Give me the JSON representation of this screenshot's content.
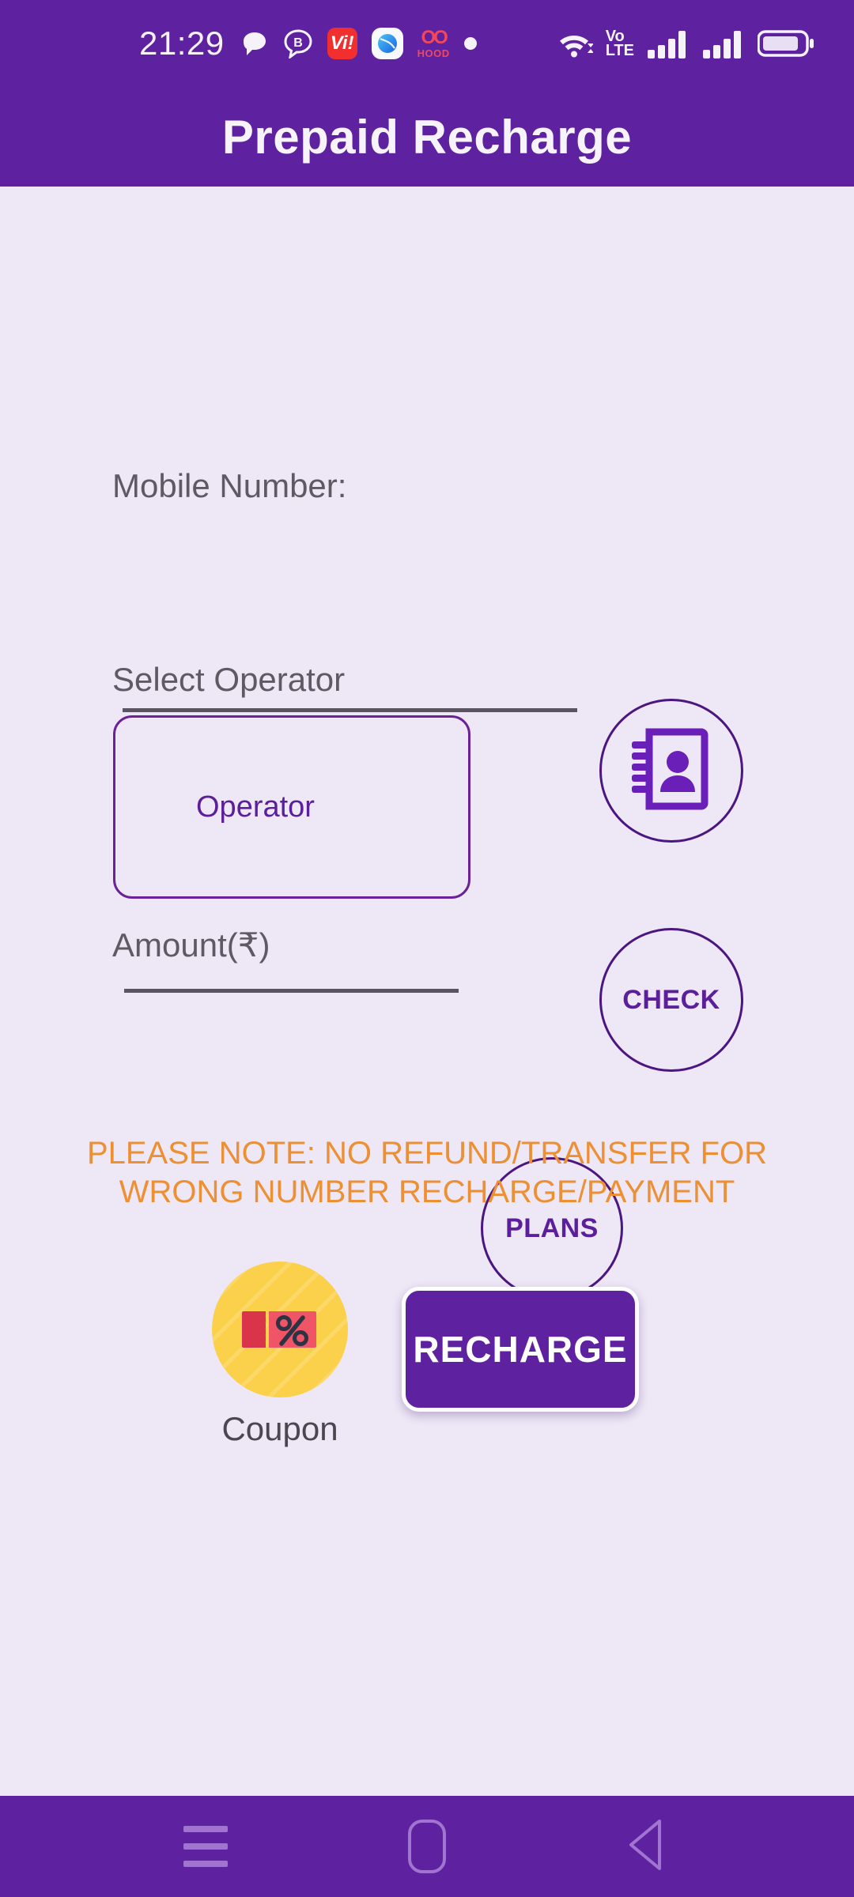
{
  "statusbar": {
    "time": "21:29",
    "notification_icons": [
      {
        "name": "chat-bubble-icon",
        "label": "chat"
      },
      {
        "name": "bubble-b-icon",
        "label": "B"
      },
      {
        "name": "vi-app-icon",
        "label": "Vi!"
      },
      {
        "name": "globe-app-icon",
        "label": "globe"
      },
      {
        "name": "hood-app-icon",
        "label": "OO",
        "sublabel": "HOOD"
      },
      {
        "name": "dot-indicator-icon",
        "label": "•"
      }
    ],
    "volte": {
      "line1": "Vo",
      "line2": "LTE"
    },
    "wifi_icon": "wifi-icon",
    "signal1_icon": "signal-bars-icon",
    "signal2_icon": "signal-bars-icon",
    "battery_icon": "battery-icon"
  },
  "header": {
    "title": "Prepaid Recharge"
  },
  "form": {
    "mobile": {
      "label": "Mobile Number:",
      "value": "",
      "placeholder": "",
      "contacts_icon": "contact-book-icon"
    },
    "operator": {
      "label": "Select Operator",
      "selected": "Operator",
      "check_button": "CHECK"
    },
    "amount": {
      "label": "Amount(₹)",
      "value": "",
      "placeholder": "",
      "plans_button": "PLANS"
    },
    "note": "PLEASE NOTE: NO REFUND/TRANSFER FOR WRONG NUMBER RECHARGE/PAYMENT",
    "coupon": {
      "label": "Coupon",
      "icon": "coupon-percent-icon"
    },
    "recharge_button": "RECHARGE"
  },
  "navbar": {
    "recents": "recents-icon",
    "home": "home-icon",
    "back": "back-icon"
  },
  "colors": {
    "brand_purple": "#5e22a0",
    "background": "#ede7f6",
    "accent_orange": "#ed8f33",
    "coupon_yellow": "#fbd04b",
    "coupon_red": "#ef4555",
    "outline_purple": "#4b1680"
  }
}
